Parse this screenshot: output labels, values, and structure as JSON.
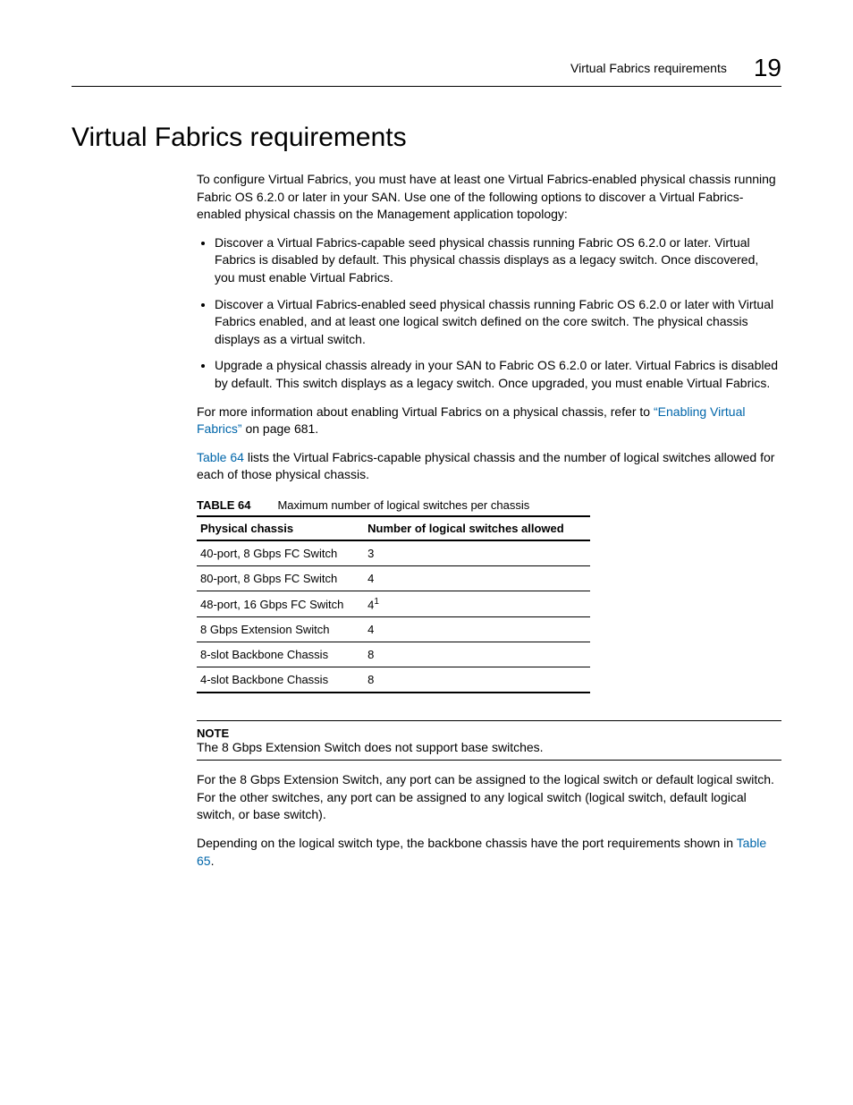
{
  "header": {
    "running_title": "Virtual Fabrics requirements",
    "chapter_number": "19"
  },
  "title": "Virtual Fabrics requirements",
  "intro": "To configure Virtual Fabrics, you must have at least one Virtual Fabrics-enabled physical chassis running Fabric OS 6.2.0 or later in your SAN. Use one of the following options to discover a Virtual Fabrics-enabled physical chassis on the Management application topology:",
  "bullets": [
    "Discover a Virtual Fabrics-capable seed physical chassis running Fabric OS 6.2.0 or later. Virtual Fabrics is disabled by default. This physical chassis displays as a legacy switch. Once discovered, you must enable Virtual Fabrics.",
    "Discover a Virtual Fabrics-enabled seed physical chassis running Fabric OS 6.2.0 or later with Virtual Fabrics enabled, and at least one logical switch defined on the core switch. The physical chassis displays as a virtual switch.",
    "Upgrade a physical chassis already in your SAN to Fabric OS 6.2.0 or later. Virtual Fabrics is disabled by default. This switch displays as a legacy switch. Once upgraded, you must enable Virtual Fabrics."
  ],
  "more_info_prefix": "For more information about enabling Virtual Fabrics on a physical chassis, refer to ",
  "more_info_link": "“Enabling Virtual Fabrics”",
  "more_info_suffix": " on page 681.",
  "table_ref_link": "Table 64",
  "table_ref_text": " lists the Virtual Fabrics-capable physical chassis and the number of logical switches allowed for each of those physical chassis.",
  "table": {
    "label": "TABLE 64",
    "caption": "Maximum number of logical switches per chassis",
    "headers": [
      "Physical chassis",
      "Number of logical switches allowed"
    ],
    "rows": [
      [
        "40-port, 8 Gbps FC Switch",
        "3"
      ],
      [
        "80-port, 8 Gbps FC Switch",
        "4"
      ],
      [
        "48-port, 16 Gbps FC Switch",
        "4"
      ],
      [
        "8 Gbps Extension Switch",
        "4"
      ],
      [
        "8-slot Backbone Chassis",
        "8"
      ],
      [
        "4-slot Backbone Chassis",
        "8"
      ]
    ],
    "footnote_row_index": 2
  },
  "note": {
    "heading": "NOTE",
    "text": "The 8 Gbps Extension Switch does not support base switches."
  },
  "para_after_note": "For the 8 Gbps Extension Switch, any port can be assigned to the logical switch or default logical switch. For the other switches, any port can be assigned to any logical switch (logical switch, default logical switch, or base switch).",
  "final_para_prefix": "Depending on the logical switch type, the backbone chassis have the port requirements shown in ",
  "final_para_link": "Table 65",
  "final_para_suffix": "."
}
